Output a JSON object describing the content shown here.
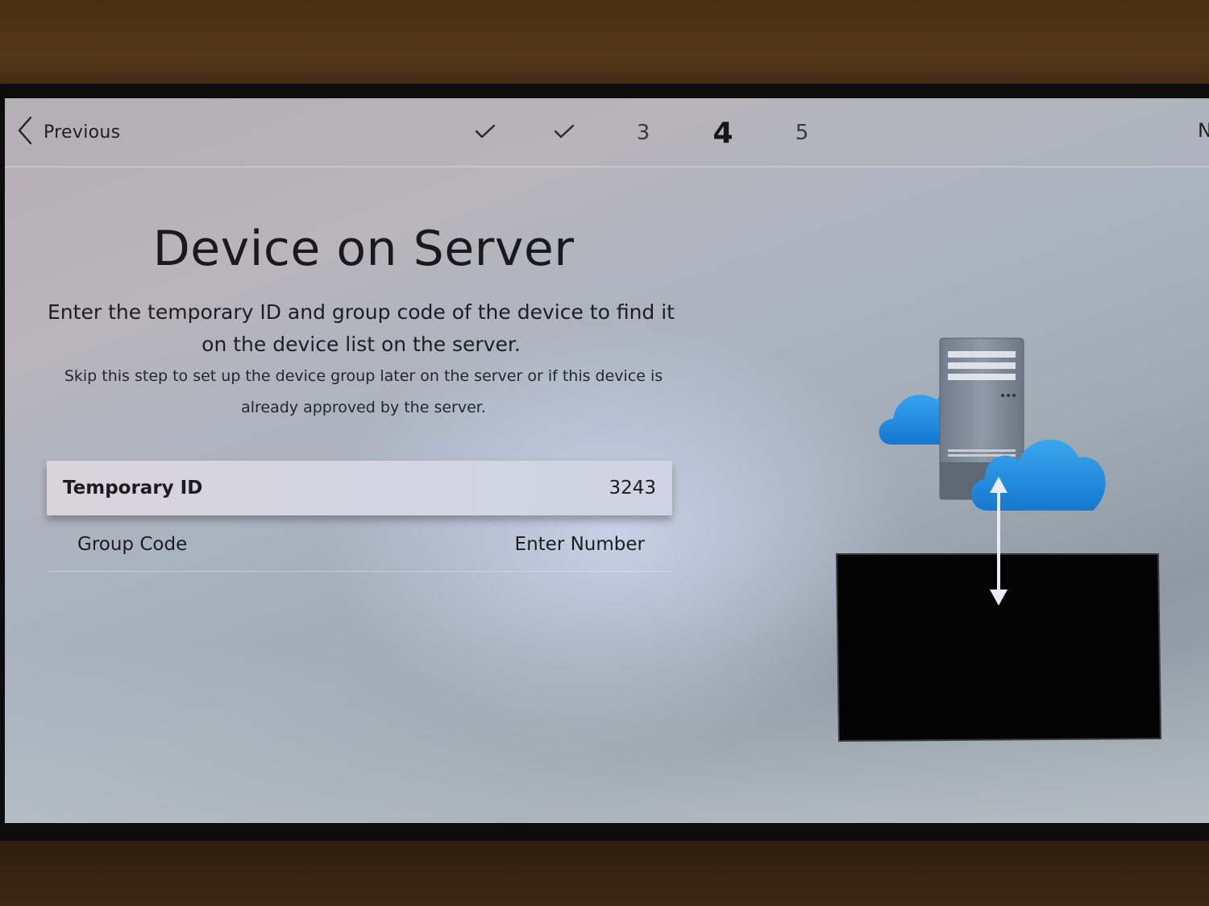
{
  "header": {
    "previous_label": "Previous",
    "steps": [
      {
        "label": "✓",
        "state": "done"
      },
      {
        "label": "✓",
        "state": "done"
      },
      {
        "label": "3",
        "state": "pending"
      },
      {
        "label": "4",
        "state": "current"
      },
      {
        "label": "5",
        "state": "pending"
      }
    ],
    "next_partial": "N"
  },
  "main": {
    "title": "Device on Server",
    "description": "Enter the temporary ID and group code of the device to find it on the device list on the server.",
    "note": "Skip this step to set up the device group later on the server or if this device is already approved by the server.",
    "fields": [
      {
        "label": "Temporary ID",
        "value": "3243",
        "focused": true
      },
      {
        "label": "Group Code",
        "value": "Enter Number",
        "focused": false
      }
    ]
  },
  "illustration": {
    "icons": [
      "server-icon",
      "cloud-icon",
      "cloud-icon",
      "double-arrow-icon",
      "display-icon"
    ],
    "colors": {
      "cloud": "#1f8fe0",
      "server": "#7d8a98",
      "display": "#030303"
    }
  }
}
